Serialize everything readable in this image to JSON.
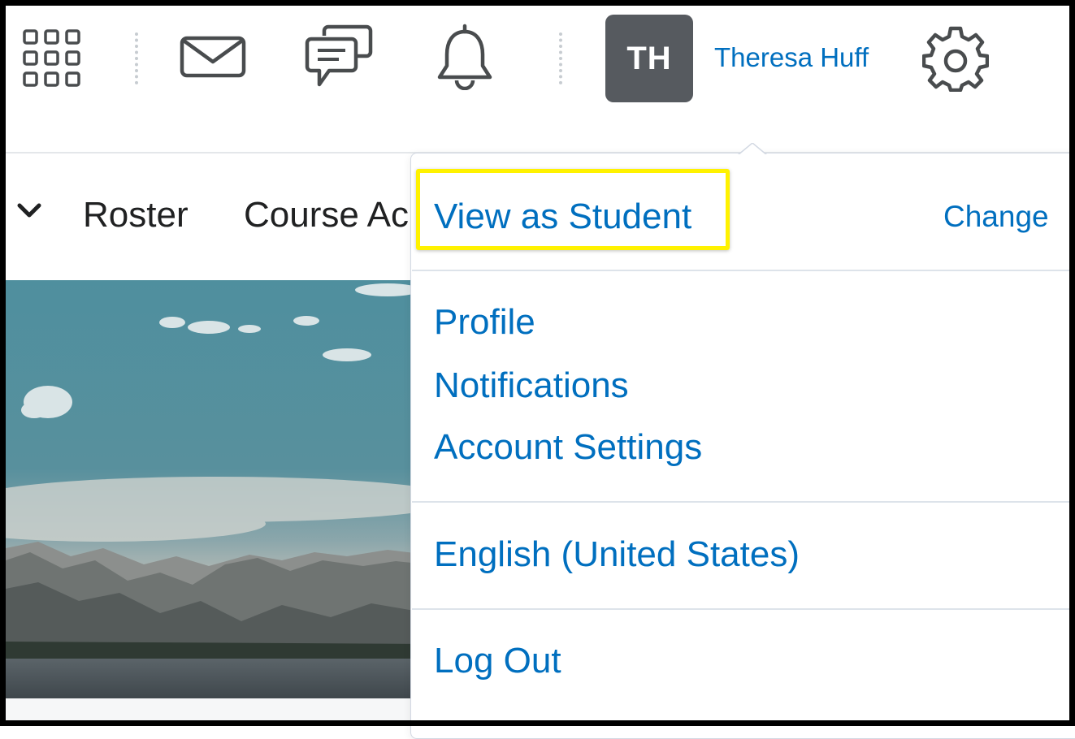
{
  "header": {
    "icons": [
      "grid-icon",
      "mail-icon",
      "chat-icon",
      "bell-icon",
      "gear-icon"
    ],
    "avatar_initials": "TH",
    "user_name": "Theresa Huff"
  },
  "nav": {
    "items": [
      "Roster",
      "Course Ac"
    ]
  },
  "dropdown": {
    "view_as_student": "View as Student",
    "change": "Change",
    "links": [
      "Profile",
      "Notifications",
      "Account Settings"
    ],
    "language": "English (United States)",
    "logout": "Log Out"
  },
  "colors": {
    "link": "#006fbf",
    "avatar_bg": "#565a5f",
    "highlight": "#fff200"
  }
}
